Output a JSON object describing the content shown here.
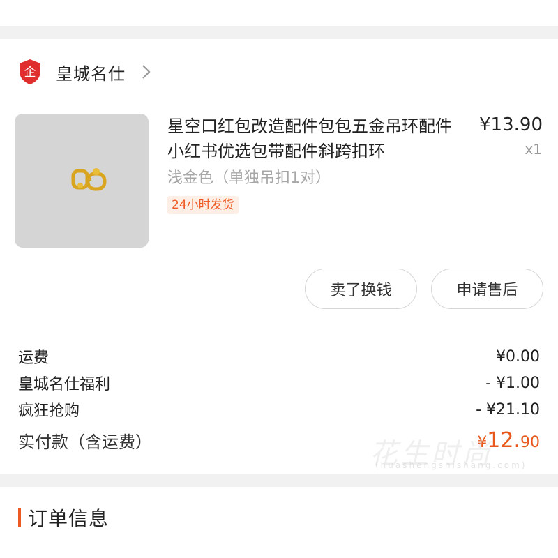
{
  "shop": {
    "badge_char": "企",
    "name": "皇城名仕"
  },
  "product": {
    "title": "星空口红包改造配件包包五金吊环配件小红书优选包带配件斜跨扣环",
    "price": "¥13.90",
    "quantity": "x1",
    "variant": "浅金色（单独吊扣1对）",
    "shipping_tag": "24小时发货"
  },
  "actions": {
    "sell_label": "卖了换钱",
    "after_sale_label": "申请售后"
  },
  "costs": [
    {
      "label": "运费",
      "value": "¥0.00"
    },
    {
      "label": "皇城名仕福利",
      "value": "- ¥1.00"
    },
    {
      "label": "疯狂抢购",
      "value": "- ¥21.10"
    }
  ],
  "paid": {
    "label": "实付款（含运费）",
    "currency": "¥",
    "integer": "12.",
    "decimal": "90"
  },
  "watermark": {
    "text": "花生时尚",
    "sub": "(huashengshishang.com)"
  },
  "order_info": {
    "title": "订单信息"
  },
  "colors": {
    "accent": "#ee5a24",
    "badge_red": "#e02d2d",
    "divider": "#f1f1f1"
  }
}
